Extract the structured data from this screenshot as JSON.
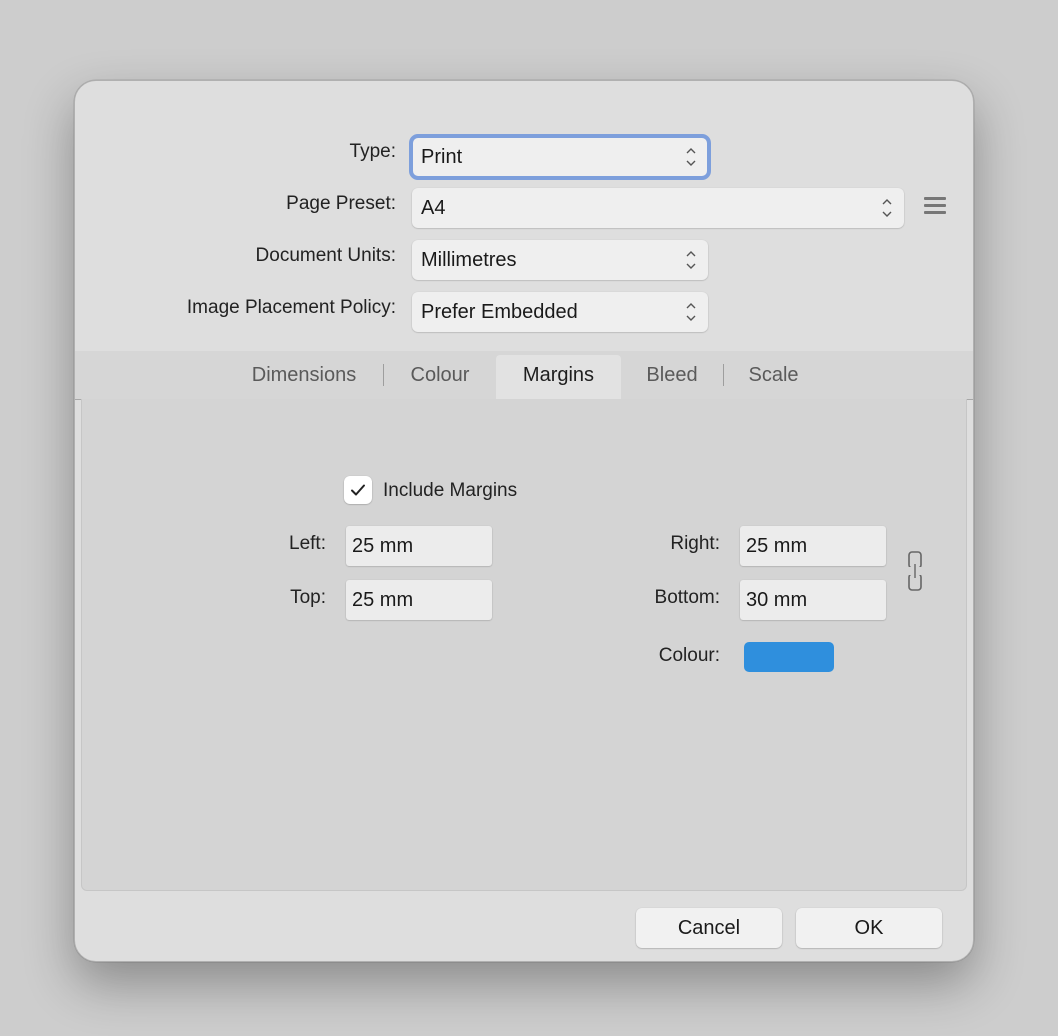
{
  "form": {
    "type_label": "Type:",
    "type_value": "Print",
    "preset_label": "Page Preset:",
    "preset_value": "A4",
    "units_label": "Document Units:",
    "units_value": "Millimetres",
    "placement_label": "Image Placement Policy:",
    "placement_value": "Prefer Embedded"
  },
  "tabs": [
    {
      "label": "Dimensions"
    },
    {
      "label": "Colour"
    },
    {
      "label": "Margins",
      "active": true
    },
    {
      "label": "Bleed"
    },
    {
      "label": "Scale"
    }
  ],
  "margins": {
    "include_label": "Include Margins",
    "include_checked": true,
    "left_label": "Left:",
    "left_value": "25 mm",
    "top_label": "Top:",
    "top_value": "25 mm",
    "right_label": "Right:",
    "right_value": "25 mm",
    "bottom_label": "Bottom:",
    "bottom_value": "30 mm",
    "colour_label": "Colour:",
    "colour_value": "#2f8fdd"
  },
  "buttons": {
    "cancel_label": "Cancel",
    "ok_label": "OK"
  },
  "icons": {
    "stepper": "up-down-chevron-icon",
    "menu": "hamburger-menu-icon",
    "link": "chain-link-icon",
    "check": "checkmark-icon"
  }
}
